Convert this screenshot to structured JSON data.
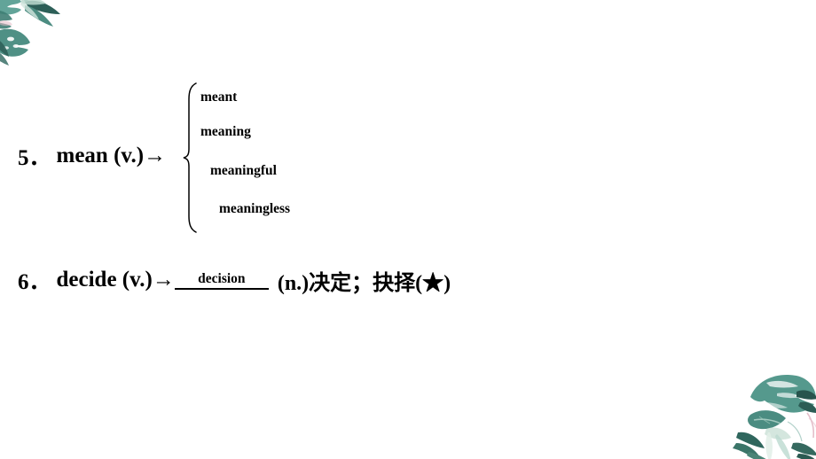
{
  "slide": {
    "background_color": "#ffffff",
    "text_color": "#000000",
    "decor_color": "#4a8f85"
  },
  "decorations": [
    {
      "name": "top-left-foliage",
      "position": "top-left"
    },
    {
      "name": "bottom-right-foliage",
      "position": "bottom-right"
    }
  ],
  "entries": [
    {
      "number": "5．",
      "word": "mean (v.)",
      "arrow": "→",
      "derivations": [
        "meant",
        "meaning",
        "meaningful",
        "meaningless"
      ]
    },
    {
      "number": "6．",
      "word": "decide (v.)",
      "arrow": "→",
      "answer": "decision",
      "definition": "(n.)决定；抉择(★)"
    }
  ]
}
